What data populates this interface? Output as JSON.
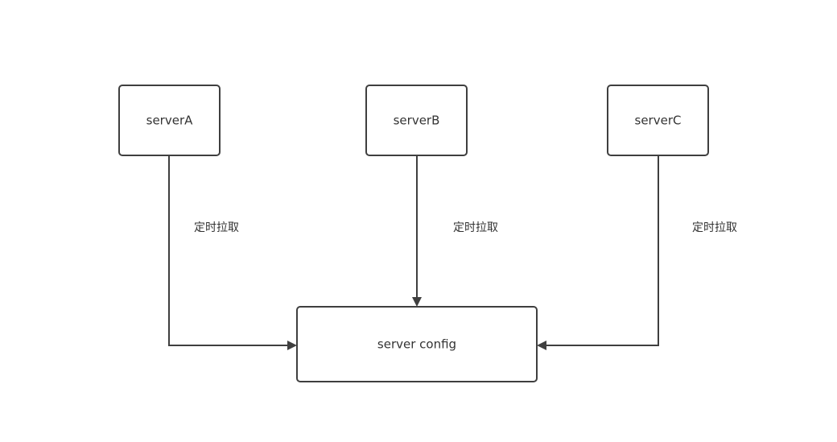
{
  "diagram": {
    "nodes": {
      "server_a": "serverA",
      "server_b": "serverB",
      "server_c": "serverC",
      "server_config": "server config"
    },
    "edges": [
      {
        "from": "server_a",
        "to": "server_config",
        "label": "定时拉取"
      },
      {
        "from": "server_b",
        "to": "server_config",
        "label": "定时拉取"
      },
      {
        "from": "server_c",
        "to": "server_config",
        "label": "定时拉取"
      }
    ],
    "colors": {
      "stroke": "#3f3f3f",
      "text": "#333333",
      "background": "#ffffff"
    }
  }
}
